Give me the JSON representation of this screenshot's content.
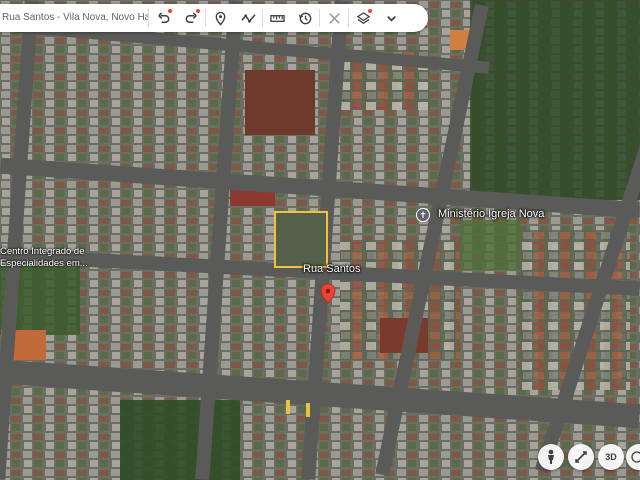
{
  "map": {
    "address": "Rua Santos - Vila Nova, Novo Hamburgo",
    "street_label": "Rua Santos",
    "poi_church": "Ministério Igreja Nova",
    "poi_center": "Centro Integrado de Especialidades em...",
    "pin_color": "#ea4335",
    "highlight_color": "#f4c13a"
  },
  "toolbar": {
    "icons": [
      "undo-icon",
      "redo-icon",
      "pin-icon",
      "path-icon",
      "ruler-icon",
      "history-icon",
      "cancel-icon",
      "layers-icon",
      "chevron-down-icon"
    ]
  },
  "controls": {
    "mode_3d": "3D",
    "icons": [
      "pegman-icon",
      "compass-icon",
      "globe-icon"
    ]
  }
}
